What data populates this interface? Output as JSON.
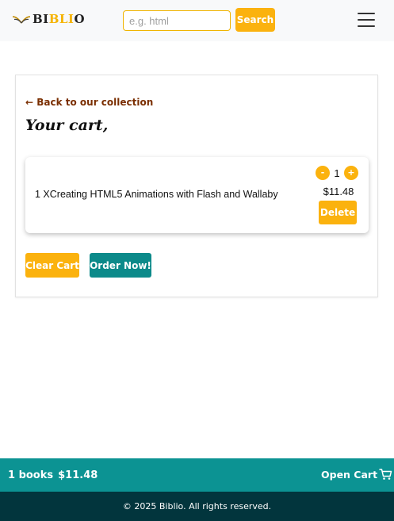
{
  "header": {
    "logo_prefix": "BI",
    "logo_accent": "BLI",
    "logo_suffix": "O",
    "search_placeholder": "e.g. html",
    "search_value": "",
    "search_label": "Search"
  },
  "cart": {
    "back_label": "← Back to our collection",
    "title": "Your cart,",
    "items": [
      {
        "text": "1 XCreating HTML5 Animations with Flash and Wallaby",
        "quantity": "1",
        "decrement_label": "-",
        "increment_label": "+",
        "price": "$11.48",
        "delete_label": "Delete"
      }
    ],
    "clear_label": "Clear Cart",
    "order_label": "Order Now!"
  },
  "cart_bar": {
    "count_text": "1 books",
    "total_text": "$11.48",
    "open_label": "Open Cart"
  },
  "footer": {
    "copyright": "© 2025 Biblio. All rights reserved."
  },
  "colors": {
    "accent": "#fbb20e",
    "teal": "#0c9393",
    "footer_bg": "#02353d",
    "link": "#7a2e00"
  },
  "icons": {
    "logo": "open-book-icon",
    "menu": "hamburger-menu-icon",
    "cart": "shopping-cart-icon"
  }
}
